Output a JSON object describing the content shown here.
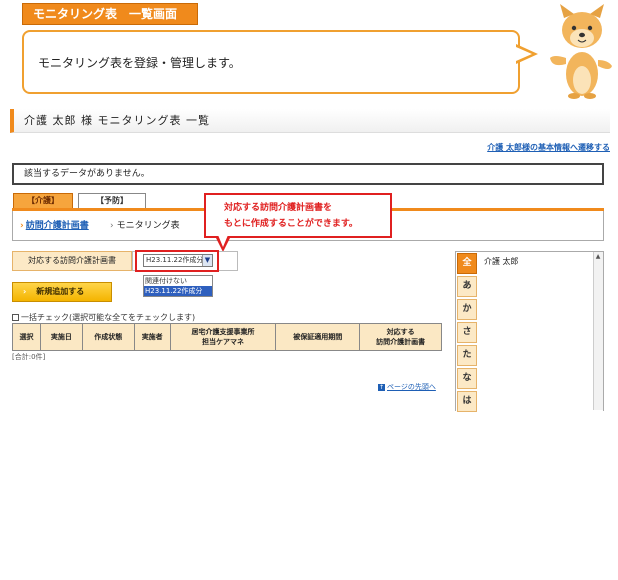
{
  "header": {
    "title": "モニタリング表　一覧画面",
    "speech": "モニタリング表を登録・管理します。"
  },
  "page": {
    "heading": "介護 太郎 様 モニタリング表 一覧",
    "top_link": "介護 太郎様の基本情報へ遷移する",
    "notice": "該当するデータがありません。"
  },
  "tabs": [
    {
      "label": "【介護】"
    },
    {
      "label": "【予防】"
    }
  ],
  "breadcrumb": {
    "item1": "訪問介護計画書",
    "item2": "モニタリング表"
  },
  "callout": {
    "line1": "対応する訪問介護計画書を",
    "line2": "もとに作成することができます。"
  },
  "select": {
    "label": "対応する訪問介護計画書",
    "value": "H23.11.22作成分",
    "options": [
      "関連付けない",
      "H23.11.22作成分"
    ]
  },
  "buttons": {
    "add": "新規追加する"
  },
  "check_all": "一括チェック(選択可能な全てをチェックします)",
  "table": {
    "headers": [
      "選択",
      "実施日",
      "作成状態",
      "実施者",
      "居宅介護支援事業所\n担当ケアマネ",
      "被保証適用期間",
      "対応する\n訪問介護計画書"
    ]
  },
  "total": "[合計:0件]",
  "page_top": "ページの先頭へ",
  "kana": {
    "items": [
      "全",
      "あ",
      "か",
      "さ",
      "た",
      "な",
      "は"
    ],
    "name": "介護 太郎"
  },
  "colors": {
    "accent": "#f08a1c",
    "link": "#1e5fb5",
    "callout": "#e02020"
  }
}
